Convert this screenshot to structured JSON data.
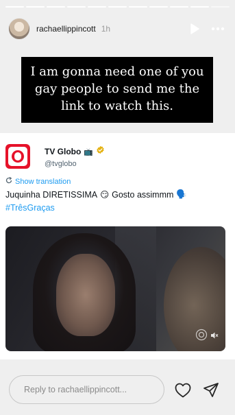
{
  "story": {
    "progress_segments": 11,
    "active_segment": 10
  },
  "header": {
    "username": "rachaellippincott",
    "time": "1h",
    "play_icon": "play-icon",
    "more_icon": "more-icon"
  },
  "caption": {
    "text": "I am gonna need one of you gay people to send me the link to watch this."
  },
  "tweet": {
    "author_name": "TV Globo",
    "author_emoji": "📺",
    "handle": "@tvglobo",
    "translate_label": "Show translation",
    "text": "Juquinha DIRETISSIMA",
    "emoji_1": "😏",
    "text_2": "Gosto assimmm",
    "emoji_2": "🗣️",
    "hashtag": "#TrêsGraças",
    "verified_color": "#e5b315",
    "link_color": "#1d9bf0"
  },
  "footer": {
    "reply_placeholder": "Reply to rachaellippincott...",
    "heart_icon": "heart-icon",
    "send_icon": "send-icon"
  }
}
